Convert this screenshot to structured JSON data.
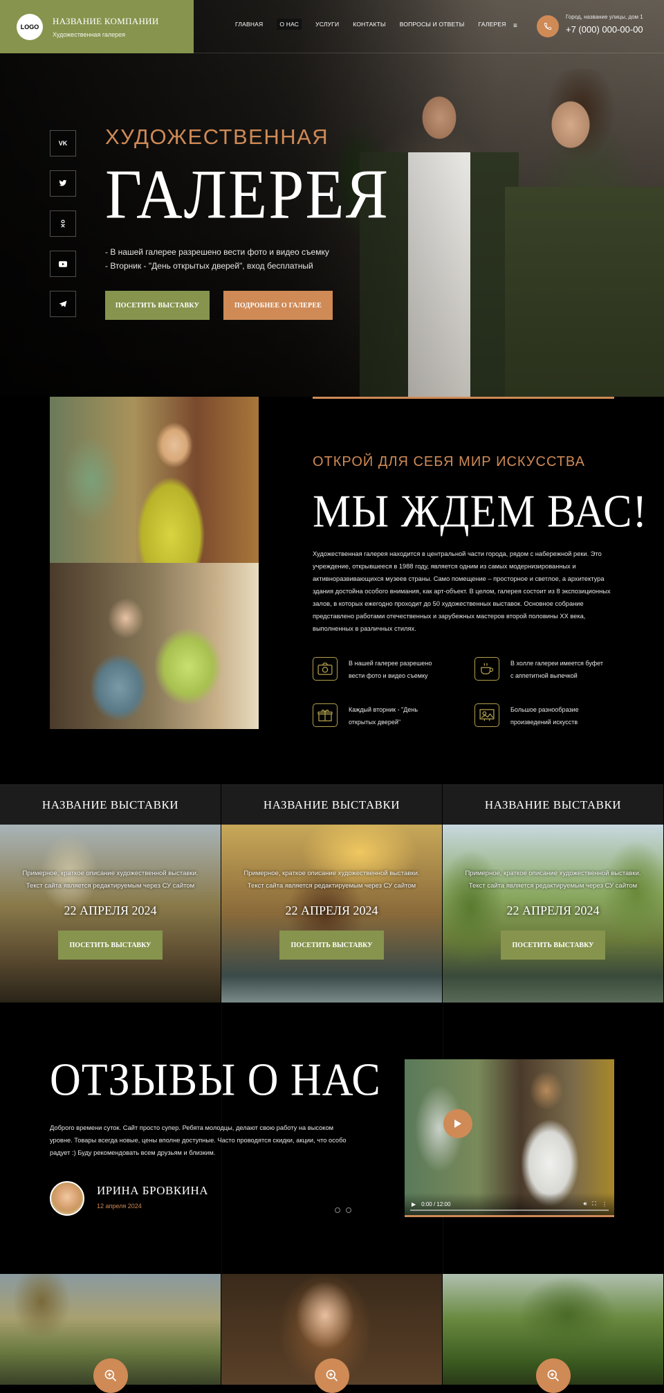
{
  "header": {
    "logo": "LOGO",
    "company_name": "НАЗВАНИЕ КОМПАНИИ",
    "company_sub": "Художественная галерея",
    "nav": [
      "ГЛАВНАЯ",
      "О НАС",
      "УСЛУГИ",
      "КОНТАКТЫ",
      "ВОПРОСЫ И ОТВЕТЫ",
      "ГАЛЕРЕЯ"
    ],
    "nav_active": "О НАС",
    "address": "Город, название улицы, дом 1",
    "phone": "+7 (000) 000-00-00"
  },
  "socials": [
    "VK",
    "twitter",
    "ok",
    "youtube",
    "telegram"
  ],
  "hero": {
    "kicker": "ХУДОЖЕСТВЕННАЯ",
    "title": "ГАЛЕРЕЯ",
    "line1": "- В нашей галерее разрешено вести фото и видео съемку",
    "line2": "- Вторник - \"День открытых дверей\", вход бесплатный",
    "btn_primary": "ПОСЕТИТЬ ВЫСТАВКУ",
    "btn_secondary": "ПОДРОБНЕЕ О ГАЛЕРЕЕ"
  },
  "about": {
    "kicker": "ОТКРОЙ ДЛЯ СЕБЯ МИР ИСКУССТВА",
    "title": "МЫ ЖДЕМ ВАС!",
    "text": "Художественная галерея находится в центральной части города, рядом с набережной реки. Это учреждение, открывшееся в 1988 году, является одним из самых модернизированных и активноразвивающихся музеев страны. Само помещение – просторное и светлое, а архитектура здания достойна особого внимания, как арт-объект. В целом, галерея состоит из 8 экспозиционных залов, в которых ежегодно проходит до 50 художественных выставок. Основное собрание представлено работами отечественных и зарубежных мастеров второй половины XX века, выполненных в различных стилях.",
    "features": [
      {
        "icon": "camera-icon",
        "text": "В нашей галерее разрешено вести фото и видео съемку"
      },
      {
        "icon": "coffee-cup-icon",
        "text": "В холле галереи имеется буфет с аппетитной выпечкой"
      },
      {
        "icon": "gift-icon",
        "text": "Каждый вторник - \"День открытых дверей\""
      },
      {
        "icon": "picture-frame-icon",
        "text": "Большое разнообразие произведений искусств"
      }
    ]
  },
  "exhibitions": [
    {
      "title": "НАЗВАНИЕ ВЫСТАВКИ",
      "desc1": "Примерное, краткое описание художественной выставки.",
      "desc2": "Текст сайта является редактируемым через СУ сайтом",
      "date": "22 АПРЕЛЯ 2024",
      "button": "ПОСЕТИТЬ ВЫСТАВКУ"
    },
    {
      "title": "НАЗВАНИЕ ВЫСТАВКИ",
      "desc1": "Примерное, краткое описание художественной выставки.",
      "desc2": "Текст сайта является редактируемым через СУ сайтом",
      "date": "22 АПРЕЛЯ 2024",
      "button": "ПОСЕТИТЬ ВЫСТАВКУ"
    },
    {
      "title": "НАЗВАНИЕ ВЫСТАВКИ",
      "desc1": "Примерное, краткое описание художественной выставки.",
      "desc2": "Текст сайта является редактируемым через СУ сайтом",
      "date": "22 АПРЕЛЯ 2024",
      "button": "ПОСЕТИТЬ ВЫСТАВКУ"
    }
  ],
  "reviews": {
    "title": "ОТЗЫВЫ О НАС",
    "text": "Доброго времени суток. Сайт просто супер. Ребята молодцы, делают свою работу на высоком уровне. Товары всегда новые, цены вполне доступные. Часто проводятся скидки, акции, что особо радует :) Буду рекомендовать всем друзьям и близким.",
    "name": "ИРИНА БРОВКИНА",
    "date": "12 апреля 2024",
    "video_time": "0:00 / 12:00"
  },
  "colors": {
    "accent_green": "#86944e",
    "accent_orange": "#cf8a56",
    "background": "#000000"
  }
}
